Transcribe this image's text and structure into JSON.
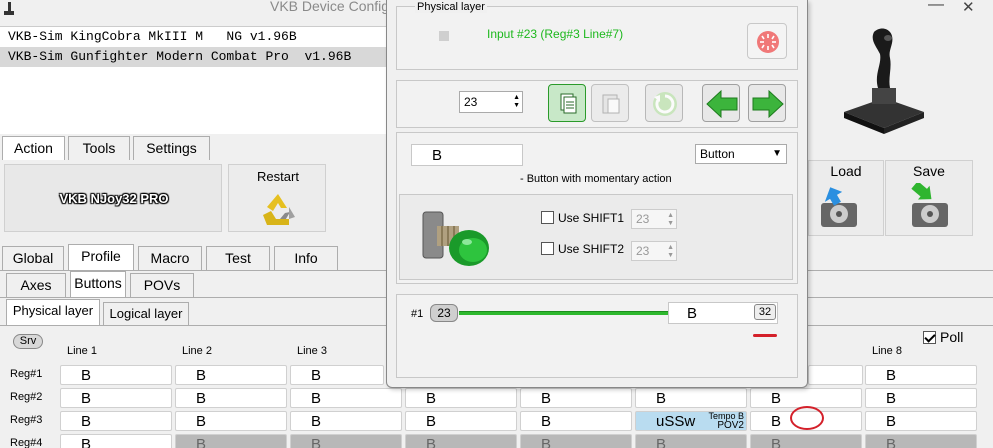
{
  "window": {
    "title": "VKB Device Config"
  },
  "devices": [
    "VKB-Sim KingCobra MkIII M   NG v1.96B",
    "VKB-Sim Gunfighter Modern Combat Pro  v1.96B"
  ],
  "top_tabs": [
    "Action",
    "Tools",
    "Settings"
  ],
  "device_name": "VKB NJoy32 PRO",
  "restart_label": "Restart",
  "load_label": "Load",
  "save_label": "Save",
  "main_tabs": [
    "Global",
    "Profile",
    "Macro",
    "Test",
    "Info"
  ],
  "sub_tabs": [
    "Axes",
    "Buttons",
    "POVs"
  ],
  "layer_tabs": [
    "Physical layer",
    "Logical layer"
  ],
  "srv_label": "Srv",
  "poll_label": "Poll",
  "columns": [
    "Line 1",
    "Line 2",
    "Line 3",
    "Line 8"
  ],
  "rows": [
    "Reg#1",
    "Reg#2",
    "Reg#3",
    "Reg#4"
  ],
  "grid": {
    "cell_value": "B",
    "usw_value": "uSSw",
    "usw_sub1": "Tempo B",
    "usw_sub2": "POV2"
  },
  "modal": {
    "group_title": "Physical layer",
    "input_label": "Input #23  (Reg#3  Line#7)",
    "number": "23",
    "name_value": "B",
    "type_value": "Button",
    "type_desc": "- Button with momentary action",
    "shift1_label": "Use SHIFT1",
    "shift1_value": "23",
    "shift2_label": "Use SHIFT2",
    "shift2_value": "23",
    "line_num": "#1",
    "line_pill": "23",
    "output_value": "B",
    "output_badge": "32"
  },
  "colors": {
    "accent_green": "#1db81d",
    "annotation_red": "#d4202a",
    "usw_cell": "#b9dcf0"
  }
}
